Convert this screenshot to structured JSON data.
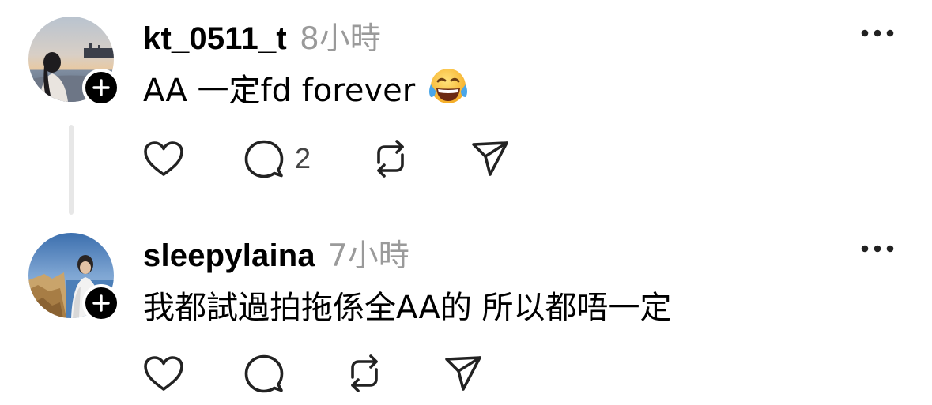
{
  "posts": [
    {
      "username": "kt_0511_t",
      "time": "8小時",
      "text": "AA 一定fd forever",
      "emoji": "face-with-tears-of-joy",
      "reply_count": "2",
      "avatar": "avatar-beach-sunset-photo"
    },
    {
      "username": "sleepylaina",
      "time": "7小時",
      "text": "我都試過拍拖係全AA的 所以都唔一定",
      "reply_count": "",
      "avatar": "avatar-coastal-cliffs-photo"
    }
  ],
  "icons": {
    "like": "heart-icon",
    "reply": "comment-bubble-icon",
    "repost": "repost-arrows-icon",
    "share": "send-paper-plane-icon",
    "more": "more-options-icon",
    "follow": "plus-icon"
  },
  "colors": {
    "text": "#000000",
    "muted": "#9a9a9a",
    "icon": "#222222",
    "thread_line": "#e7e7e7"
  }
}
